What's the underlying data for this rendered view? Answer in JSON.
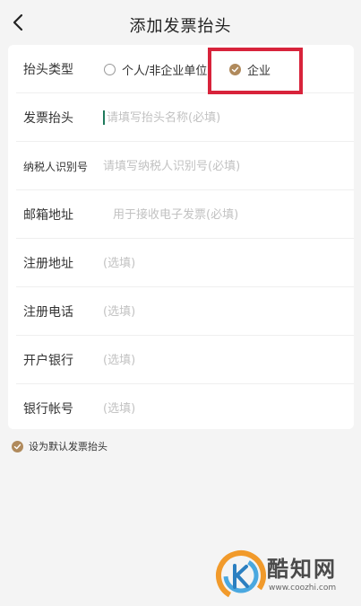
{
  "header": {
    "title": "添加发票抬头",
    "back_icon": "chevron-left-icon"
  },
  "form": {
    "type_label": "抬头类型",
    "type_options": [
      {
        "label": "个人/非企业单位",
        "selected": false
      },
      {
        "label": "企业",
        "selected": true
      }
    ],
    "title_label": "发票抬头",
    "title_placeholder": "请填写抬头名称(必填)",
    "taxid_label": "纳税人识别号",
    "taxid_placeholder": "请填写纳税人识别号(必填)",
    "email_label": "邮箱地址",
    "email_placeholder": "用于接收电子发票(必填)",
    "address_label": "注册地址",
    "address_placeholder": "(选填)",
    "phone_label": "注册电话",
    "phone_placeholder": "(选填)",
    "bank_label": "开户银行",
    "bank_placeholder": "(选填)",
    "account_label": "银行帐号",
    "account_placeholder": "(选填)"
  },
  "default_option": {
    "label": "设为默认发票抬头",
    "checked": true
  },
  "colors": {
    "accent": "#b08a5c",
    "highlight": "#d8233b",
    "cursor": "#1f7a5c"
  },
  "watermark": {
    "text": "酷知网",
    "url": "www.coozhi.com"
  }
}
